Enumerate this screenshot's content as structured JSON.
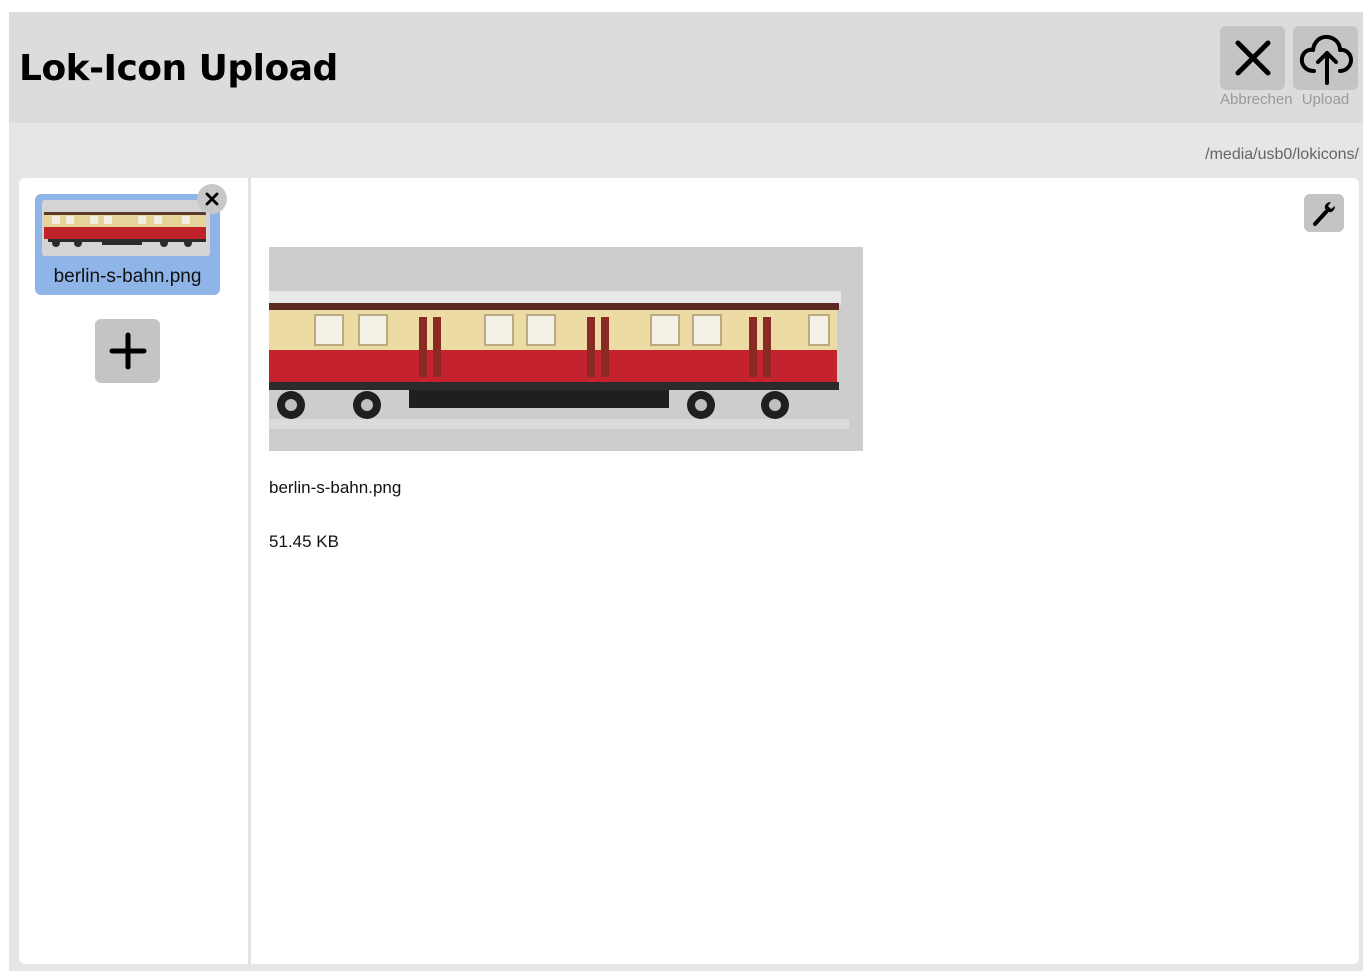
{
  "header": {
    "title": "Lok-Icon Upload",
    "cancel_label": "Abbrechen",
    "upload_label": "Upload"
  },
  "path": "/media/usb0/lokicons/",
  "files": [
    {
      "name": "berlin-s-bahn.png"
    }
  ],
  "detail": {
    "name": "berlin-s-bahn.png",
    "size": "51.45 KB"
  },
  "colors": {
    "selected": "#8fb4e8",
    "button": "#c4c4c4",
    "header_bg": "#dcdcdc"
  },
  "icons": {
    "cancel": "close-icon",
    "upload": "cloud-upload-icon",
    "remove": "close-icon",
    "add": "plus-icon",
    "settings": "wrench-icon"
  }
}
